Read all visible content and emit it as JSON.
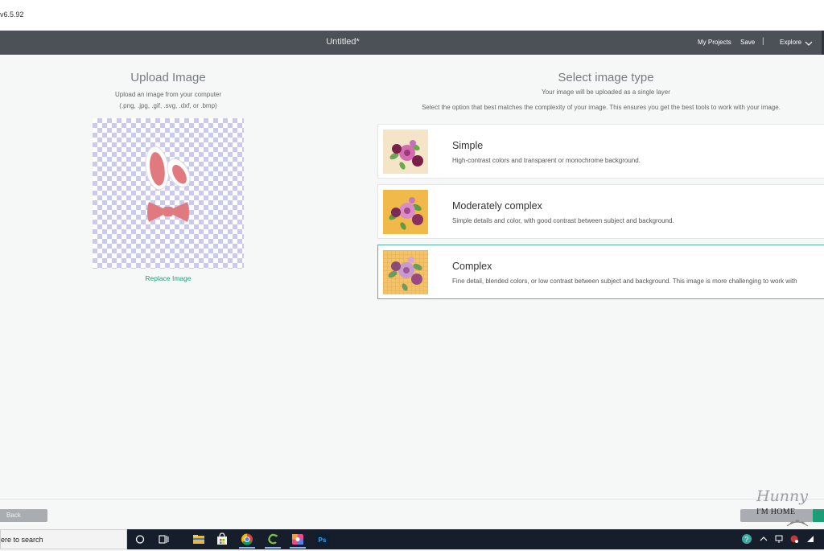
{
  "window": {
    "version_text": "v6.5.92"
  },
  "topbar": {
    "title": "Untitled*",
    "my_projects": "My Projects",
    "save": "Save",
    "separator": "|",
    "explore": "Explore"
  },
  "upload": {
    "title": "Upload Image",
    "subtitle": "Upload an image from your computer",
    "formats": "(.png, .jpg, .gif, .svg, .dxf, or .bmp)",
    "replace_link": "Replace Image"
  },
  "image_type": {
    "title": "Select image type",
    "subtitle": "Your image will be uploaded as a single layer",
    "instruction": "Select the option that best matches the complexity of your image. This ensures you get the best tools to work with your image.",
    "selected_index": 2,
    "options": [
      {
        "name": "Simple",
        "description": "High-contrast colors and transparent or monochrome background.",
        "thumb_bg": "#f4e4c8"
      },
      {
        "name": "Moderately complex",
        "description": "Simple details and color, with good contrast between subject and background.",
        "thumb_bg": "#f0b94a"
      },
      {
        "name": "Complex",
        "description": "Fine detail, blended colors, or low contrast between subject and background. This image is more challenging to work with",
        "thumb_bg": "#f3c36a"
      }
    ]
  },
  "footer": {
    "back": "Back"
  },
  "watermark": {
    "script": "Hunny",
    "caps": "I'M HOME"
  },
  "taskbar": {
    "search_text": "ere to search",
    "icons": [
      "task-view-icon",
      "timeline-icon",
      "file-explorer-icon",
      "store-icon",
      "chrome-icon",
      "cricut-icon",
      "photos-icon",
      "photoshop-icon"
    ],
    "photoshop_label": "Ps"
  },
  "colors": {
    "accent": "#1a9e78",
    "topbar": "#4b5157",
    "taskbar": "#151e2a",
    "selected_border": "#4fb8a0",
    "preview_shape": "#e07a7f"
  }
}
